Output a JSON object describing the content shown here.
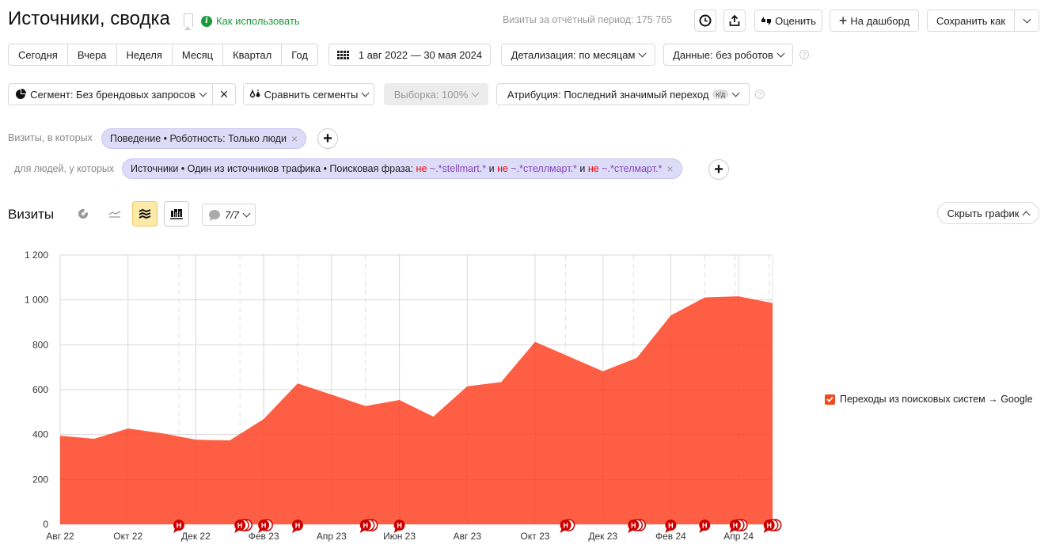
{
  "header": {
    "title": "Источники, сводка",
    "how_to_use": "Как использовать",
    "visits_total_label": "Визиты за отчётный период: 175 765",
    "rate_label": "Оценить",
    "dashboard_label": "На дашборд",
    "save_as_label": "Сохранить как"
  },
  "periods": [
    "Сегодня",
    "Вчера",
    "Неделя",
    "Месяц",
    "Квартал",
    "Год"
  ],
  "date_range": "1 авг 2022 — 30 мая 2024",
  "detail_label": "Детализация: по месяцам",
  "data_label": "Данные: без роботов",
  "segment_label": "Сегмент: Без брендовых запросов",
  "compare_label": "Сравнить сегменты",
  "sample_label": "Выборка: 100%",
  "attribution_label": "Атрибуция: Последний значимый переход",
  "attribution_badge": "к/д",
  "filters": {
    "visits_prefix": "Визиты, в которых",
    "visits_chip": "Поведение • Роботность: Только люди",
    "people_prefix": "для людей, у которых",
    "people_chip_prefix": "Источники • Один из источников трафика • Поисковая фраза: ",
    "people_chip_parts": [
      {
        "neg": "не",
        "value": "~.*stellmart.*"
      },
      {
        "join": "и"
      },
      {
        "neg": "не",
        "value": "~.*стеллмарт.*"
      },
      {
        "join": "и"
      },
      {
        "neg": "не",
        "value": "~.*стелмарт.*"
      }
    ]
  },
  "chart_section": {
    "title": "Визиты",
    "annotations_count": "7/7",
    "hide_chart_label": "Скрыть график"
  },
  "chart_data": {
    "type": "area",
    "title": "Визиты",
    "x": [
      "Авг 22",
      "Сен 22",
      "Окт 22",
      "Ноя 22",
      "Дек 22",
      "Янв 23",
      "Фев 23",
      "Мар 23",
      "Апр 23",
      "Май 23",
      "Июн 23",
      "Июл 23",
      "Авг 23",
      "Сен 23",
      "Окт 23",
      "Ноя 23",
      "Дек 23",
      "Янв 24",
      "Фев 24",
      "Мар 24",
      "Апр 24",
      "Май 24"
    ],
    "x_tick_labels": [
      "Авг 22",
      "Окт 22",
      "Дек 22",
      "Фев 23",
      "Апр 23",
      "Июн 23",
      "Авг 23",
      "Окт 23",
      "Дек 23",
      "Фев 24",
      "Апр 24"
    ],
    "series": [
      {
        "name": "Переходы из поисковых систем → Google",
        "color": "#fe5a3e",
        "values": [
          395,
          381,
          427,
          406,
          377,
          374,
          469,
          628,
          578,
          527,
          554,
          480,
          615,
          634,
          813,
          748,
          682,
          742,
          931,
          1011,
          1016,
          986
        ]
      }
    ],
    "yticks": [
      0,
      200,
      400,
      600,
      800,
      1000,
      1200
    ],
    "ytick_labels": [
      "0",
      "200",
      "400",
      "600",
      "800",
      "1 000",
      "1 200"
    ],
    "ylim": [
      0,
      1200
    ],
    "grid": true,
    "legend_position": "right",
    "annotations": [
      {
        "month_index": 3.5,
        "count": 1,
        "label": "Н"
      },
      {
        "month_index": 5.3,
        "count": 3,
        "label": "Н"
      },
      {
        "month_index": 6.0,
        "count": 2,
        "label": "Н"
      },
      {
        "month_index": 7.0,
        "count": 1,
        "label": "Н"
      },
      {
        "month_index": 9.0,
        "count": 3,
        "label": "Н"
      },
      {
        "month_index": 10.0,
        "count": 1,
        "label": "Н"
      },
      {
        "month_index": 14.9,
        "count": 2,
        "label": "Н"
      },
      {
        "month_index": 16.9,
        "count": 3,
        "label": "Н"
      },
      {
        "month_index": 18.0,
        "count": 1,
        "label": "Н"
      },
      {
        "month_index": 19.0,
        "count": 1,
        "label": "Н"
      },
      {
        "month_index": 19.9,
        "count": 3,
        "label": "Н"
      },
      {
        "month_index": 20.9,
        "count": 3,
        "label": "Н"
      }
    ]
  },
  "colors": {
    "accent_green": "#1a9a3a",
    "area": "#fe5a3e",
    "annotation": "#cc0000",
    "chip_bg": "#dcdcf8",
    "active_tool": "#fde9a8"
  }
}
